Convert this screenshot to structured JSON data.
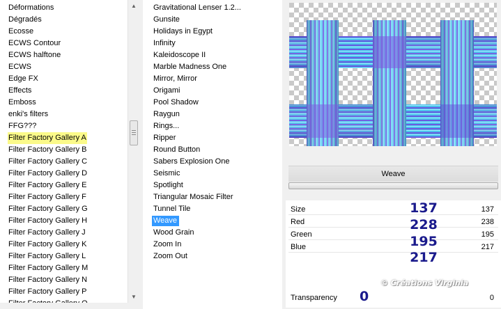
{
  "left_list": {
    "items": [
      "Déformations",
      "Dégradés",
      "Ecosse",
      "ECWS Contour",
      "ECWS halftone",
      "ECWS",
      "Edge FX",
      "Effects",
      "Emboss",
      "enki's filters",
      "FFG???",
      "Filter Factory Gallery A",
      "Filter Factory Gallery B",
      "Filter Factory Gallery C",
      "Filter Factory Gallery D",
      "Filter Factory Gallery E",
      "Filter Factory Gallery F",
      "Filter Factory Gallery G",
      "Filter Factory Gallery H",
      "Filter Factory Gallery J",
      "Filter Factory Gallery K",
      "Filter Factory Gallery L",
      "Filter Factory Gallery M",
      "Filter Factory Gallery N",
      "Filter Factory Gallery P",
      "Filter Factory Gallery Q"
    ],
    "highlighted": "Filter Factory Gallery A"
  },
  "mid_list": {
    "items": [
      "Gravitational Lenser 1.2...",
      "Gunsite",
      "Holidays in Egypt",
      "Infinity",
      "Kaleidoscope II",
      "Marble Madness One",
      "Mirror, Mirror",
      "Origami",
      "Pool Shadow",
      "Raygun",
      "Rings...",
      "Ripper",
      "Round Button",
      "Sabers Explosion One",
      "Seismic",
      "Spotlight",
      "Triangular Mosaic Filter",
      "Tunnel Tile",
      "Weave",
      "Wood Grain",
      "Zoom In",
      "Zoom Out"
    ],
    "selected": "Weave"
  },
  "preview": {
    "icon": "weave-preview-image"
  },
  "filter_name": "Weave",
  "progress": 0,
  "params": [
    {
      "label": "Size",
      "value": "137"
    },
    {
      "label": "Red",
      "value": "238"
    },
    {
      "label": "Green",
      "value": "195"
    },
    {
      "label": "Blue",
      "value": "217"
    }
  ],
  "overlay_values": [
    "137",
    "228",
    "195",
    "217"
  ],
  "transparency": {
    "label": "Transparency",
    "overlay": "0",
    "value": "0"
  },
  "watermark": "© Créations Virginia",
  "colors": {
    "selection": "#3399ff",
    "highlight": "#fbfa8a",
    "overlay_number": "#1a1a8c"
  }
}
